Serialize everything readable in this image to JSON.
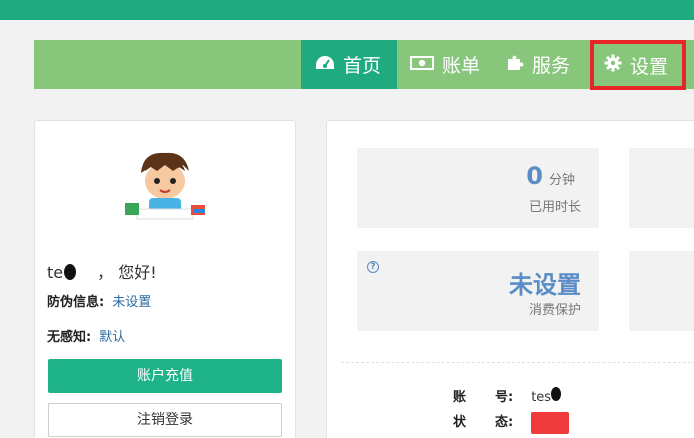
{
  "nav": {
    "items": [
      {
        "label": "首页",
        "icon": "dashboard-icon"
      },
      {
        "label": "账单",
        "icon": "money-icon"
      },
      {
        "label": "服务",
        "icon": "puzzle-icon"
      },
      {
        "label": "设置",
        "icon": "gear-icon"
      }
    ],
    "active_color": "#1faa7f",
    "bar_color": "#88c67c",
    "highlight_color": "#e8262a"
  },
  "profile": {
    "username": "te",
    "greeting": "，  您好!",
    "anti_fake_label": "防伪信息:",
    "anti_fake_value": "未设置",
    "silent_label": "无感知:",
    "silent_value": "默认",
    "recharge_label": "账户充值",
    "logout_label": "注销登录"
  },
  "stats": {
    "usage_value": "0",
    "usage_unit": "分钟",
    "usage_label": "已用时长",
    "protect_value": "未设置",
    "protect_label": "消费保护",
    "help_mark": "?"
  },
  "account": {
    "account_key1": "账",
    "account_key2": "号:",
    "account_value": "tes",
    "status_key1": "状",
    "status_key2": "态:"
  }
}
